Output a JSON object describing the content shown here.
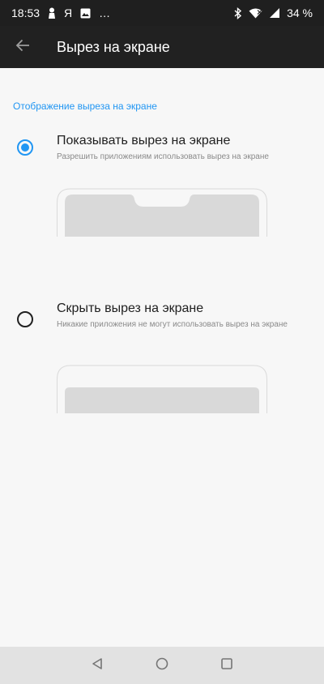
{
  "status_bar": {
    "time": "18:53",
    "carrier_icon": "Я",
    "more_notifications": "…",
    "battery": "34 %",
    "icons": [
      "person-icon",
      "yandex-icon",
      "image-icon",
      "bluetooth-icon",
      "wifi-icon",
      "signal-icon",
      "battery-icon"
    ]
  },
  "app_bar": {
    "title": "Вырез на экране",
    "back_icon": "arrow-back-icon"
  },
  "section": {
    "header": "Отображение выреза на экране"
  },
  "options": [
    {
      "title": "Показывать вырез на экране",
      "subtitle": "Разрешить приложениям использовать вырез на экране",
      "selected": true
    },
    {
      "title": "Скрыть вырез на экране",
      "subtitle": "Никакие приложения не могут использовать вырез на экране",
      "selected": false
    }
  ],
  "colors": {
    "accent": "#2196f3",
    "app_bar": "#212121",
    "background": "#f7f7f7",
    "preview_fill": "#d9d9d9"
  },
  "nav_bar": {
    "icons": [
      "back-triangle-icon",
      "home-circle-icon",
      "recents-square-icon"
    ]
  }
}
